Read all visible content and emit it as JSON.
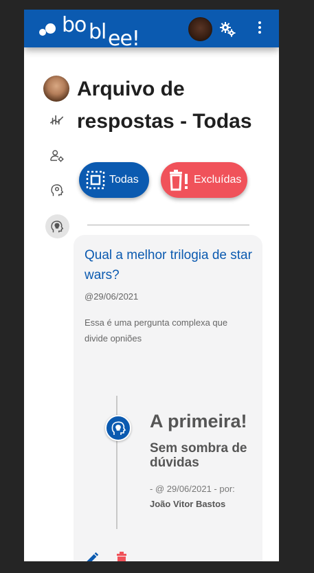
{
  "app": {
    "logo_text_1": "bo",
    "logo_text_2": "bl",
    "logo_text_3": "ee!"
  },
  "topbar": {
    "avatar": "user-avatar",
    "settings_icon": "gears-icon",
    "menu_icon": "kebab-menu-icon",
    "color": "#0b5ab0"
  },
  "sidebar": {
    "items": [
      {
        "name": "profile-avatar"
      },
      {
        "name": "stats-icon"
      },
      {
        "name": "user-settings-icon"
      },
      {
        "name": "head-gear-icon"
      },
      {
        "name": "answers-archive-icon",
        "active": true
      }
    ]
  },
  "page": {
    "title": "Arquivo de respostas - Todas"
  },
  "filters": {
    "all_label": "Todas",
    "deleted_label": "Excluídas",
    "all_color": "#0b5ab0",
    "deleted_color": "#f0525a"
  },
  "question": {
    "title": "Qual a melhor trilogia de star wars?",
    "date": "@29/06/2021",
    "description": "Essa é uma pergunta complexa que divide opniões"
  },
  "answer": {
    "title": "A primeira!",
    "subtitle": "Sem sombra de dúvidas",
    "meta": "- @ 29/06/2021 - por:",
    "author": "João Vitor Bastos"
  }
}
